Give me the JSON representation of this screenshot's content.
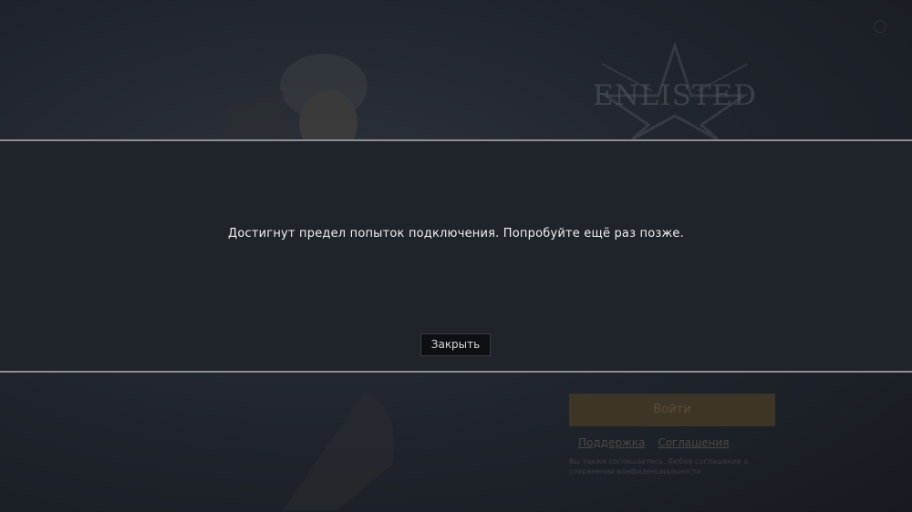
{
  "background": {
    "logo_text": "ENLISTED"
  },
  "login": {
    "login_button_label": "Войти",
    "links": [
      "Поддержка",
      "Соглашения"
    ],
    "note": "Вы также соглашаетесь. Любое соглашение о сохранении конфиденциальности"
  },
  "dialog": {
    "message": "Достигнут предел попыток подключения. Попробуйте ещё раз позже.",
    "close_label": "Закрыть"
  },
  "colors": {
    "modal_bg": "#1f232a",
    "modal_border": "#8c8f93",
    "button_bg": "#0d0f12",
    "login_button_bg": "#3d3526"
  }
}
